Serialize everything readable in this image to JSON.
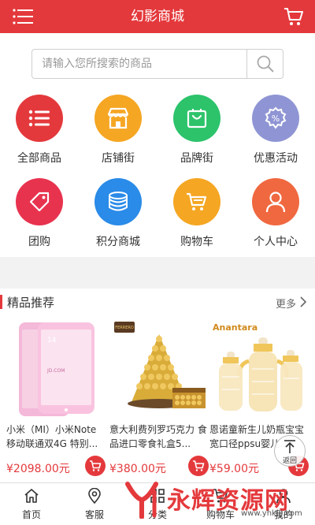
{
  "header": {
    "title": "幻影商城",
    "menu_icon": "menu-icon",
    "cart_icon": "cart-icon"
  },
  "search": {
    "placeholder": "请输入您所搜索的商品",
    "value": "",
    "icon": "search-icon"
  },
  "categories": [
    {
      "label": "全部商品",
      "icon": "list-icon",
      "color": "#e4393c"
    },
    {
      "label": "店铺街",
      "icon": "store-icon",
      "color": "#f5a623"
    },
    {
      "label": "品牌街",
      "icon": "bag-icon",
      "color": "#2cc36b"
    },
    {
      "label": "优惠活动",
      "icon": "coupon-icon",
      "color": "#8f95d4"
    },
    {
      "label": "团购",
      "icon": "tag-icon",
      "color": "#e8334f"
    },
    {
      "label": "积分商城",
      "icon": "coins-icon",
      "color": "#2a8be8"
    },
    {
      "label": "购物车",
      "icon": "cart-icon",
      "color": "#f5a623"
    },
    {
      "label": "个人中心",
      "icon": "user-icon",
      "color": "#f0683f"
    }
  ],
  "featured": {
    "title": "精品推荐",
    "more_label": "更多",
    "products": [
      {
        "name": "小米（MI）小米Note 移动联通双4G 特别...",
        "price": "¥2098.00元",
        "image": "pink-phone-image"
      },
      {
        "name": "意大利费列罗巧克力 食品进口零食礼盒5...",
        "price": "¥380.00元",
        "image": "chocolate-tower-image"
      },
      {
        "name": "恩诺童新生儿奶瓶宝宝宽口径ppsu婴儿...",
        "price": "¥59.00元",
        "image": "baby-bottles-image",
        "brand": "Anantara"
      }
    ]
  },
  "back_to_top": {
    "label": "返回"
  },
  "tabbar": {
    "items": [
      {
        "label": "首页",
        "icon": "home-icon"
      },
      {
        "label": "客服",
        "icon": "location-icon"
      },
      {
        "label": "分类",
        "icon": "grid-icon"
      },
      {
        "label": "购物车",
        "icon": "cart-icon"
      },
      {
        "label": "我的",
        "icon": "user-icon"
      }
    ]
  },
  "watermark": {
    "text": "永辉资源网",
    "url": "www.yhkjjj.com"
  },
  "colors": {
    "primary": "#e4393c",
    "background": "#f2f2f2"
  }
}
